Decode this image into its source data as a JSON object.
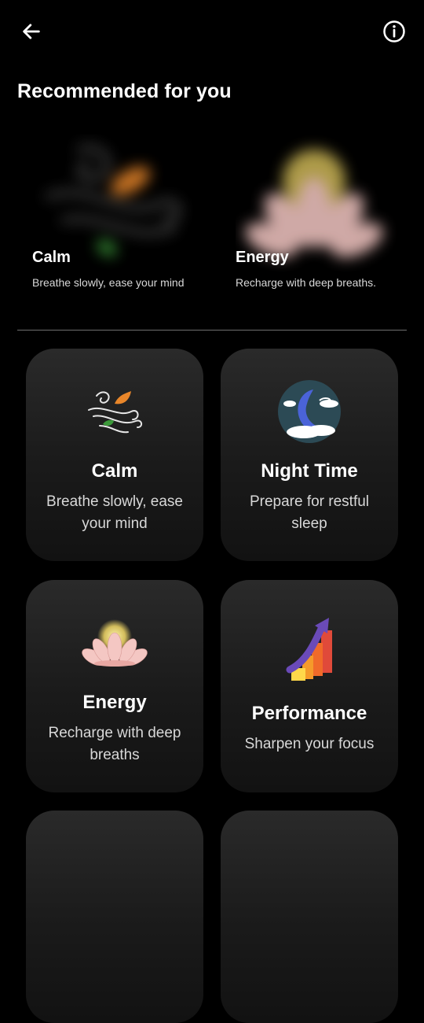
{
  "header": {
    "back_icon": "arrow-left-icon",
    "info_icon": "info-circle-icon"
  },
  "recommended": {
    "title": "Recommended for you",
    "items": [
      {
        "title": "Calm",
        "subtitle": "Breathe slowly, ease your mind",
        "icon": "wind-leaf-icon"
      },
      {
        "title": "Energy",
        "subtitle": "Recharge with deep breaths.",
        "icon": "lotus-icon"
      }
    ]
  },
  "grid": {
    "items": [
      {
        "title": "Calm",
        "subtitle": "Breathe slowly, ease your mind",
        "icon": "wind-leaf-icon"
      },
      {
        "title": "Night Time",
        "subtitle": "Prepare for restful sleep",
        "icon": "moon-clouds-icon"
      },
      {
        "title": "Energy",
        "subtitle": "Recharge with deep breaths",
        "icon": "lotus-icon"
      },
      {
        "title": "Performance",
        "subtitle": "Sharpen your focus",
        "icon": "rising-chart-icon"
      }
    ]
  },
  "colors": {
    "background": "#000000",
    "card": "#1e1e1e",
    "text": "#ffffff",
    "muted": "#d8d8d8",
    "leaf_orange": "#e8862a",
    "leaf_green": "#3c9a3a",
    "lotus_pink": "#f4c7c3",
    "glow_yellow": "#ffe36a",
    "moon_blue": "#4a63d8",
    "arrow_purple": "#6a4ab8",
    "bar_red": "#e04a3a"
  }
}
